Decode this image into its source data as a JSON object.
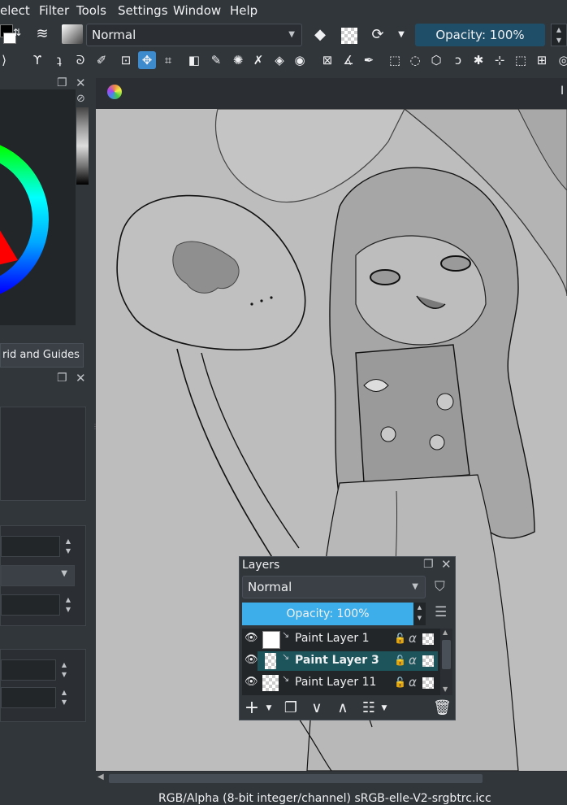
{
  "menu": {
    "items": [
      "elect",
      "Filter",
      "Tools",
      "Settings",
      "Window",
      "Help"
    ]
  },
  "toolbar": {
    "blend_mode": "Normal",
    "opacity_label": "Opacity: 100%"
  },
  "left_docker": {
    "tab_label": "rid and Guides"
  },
  "layers": {
    "title": "Layers",
    "blend_mode": "Normal",
    "opacity_label": "Opacity: 100%",
    "items": [
      {
        "name": "Paint Layer 1",
        "selected": false
      },
      {
        "name": "Paint Layer 3",
        "selected": true
      },
      {
        "name": "Paint Layer 11",
        "selected": false
      }
    ]
  },
  "document_tab": {
    "label": "I"
  },
  "status": {
    "color_profile": "RGB/Alpha (8-bit integer/channel)  sRGB-elle-V2-srgbtrc.icc"
  },
  "colors": {
    "background": "#31363b",
    "accent": "#3daee9",
    "selection": "#1d545c",
    "canvas": "#bdbdbd"
  }
}
